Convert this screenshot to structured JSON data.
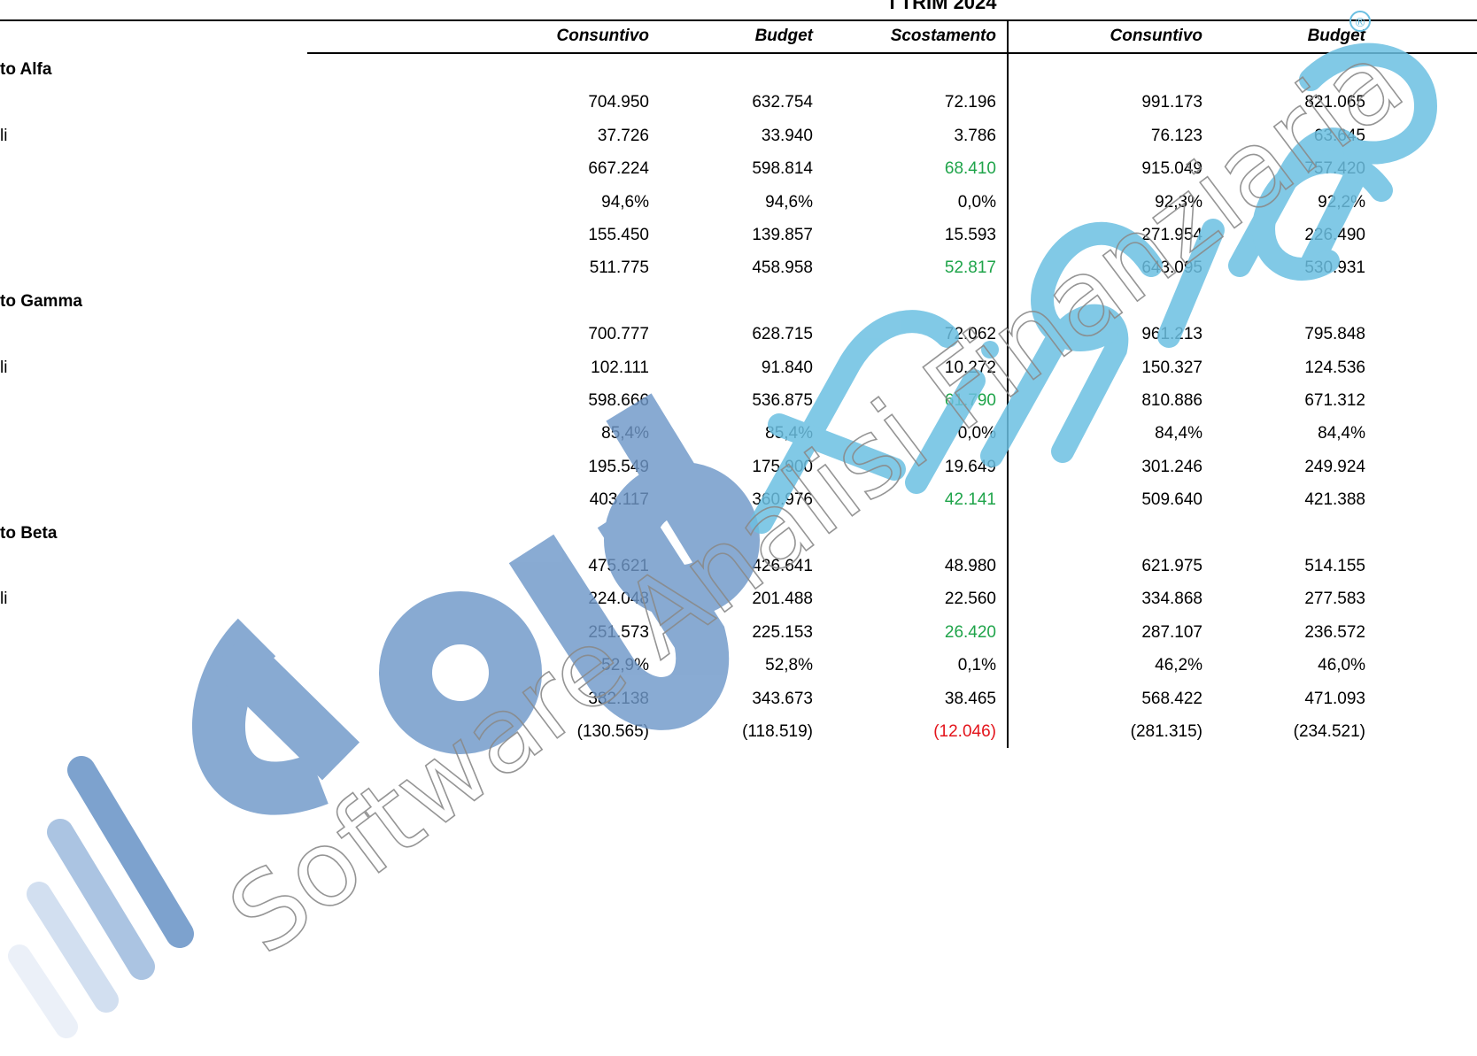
{
  "header": {
    "period": "I TRIM 2024",
    "columns": [
      "Consuntivo",
      "Budget",
      "Scostamento",
      "Consuntivo",
      "Budget"
    ]
  },
  "rows": [
    {
      "label": "to Alfa",
      "group": true,
      "values": [
        "",
        "",
        "",
        "",
        ""
      ]
    },
    {
      "label": "",
      "values": [
        "704.950",
        "632.754",
        "72.196",
        "991.173",
        "821.065"
      ]
    },
    {
      "label": "li",
      "values": [
        "37.726",
        "33.940",
        "3.786",
        "76.123",
        "63.645"
      ]
    },
    {
      "label": "",
      "values": [
        "667.224",
        "598.814",
        "68.410",
        "915.049",
        "757.420"
      ],
      "var_class": "pos"
    },
    {
      "label": "",
      "values": [
        "94,6%",
        "94,6%",
        "0,0%",
        "92,3%",
        "92,2%"
      ]
    },
    {
      "label": "",
      "values": [
        "155.450",
        "139.857",
        "15.593",
        "271.954",
        "226.490"
      ]
    },
    {
      "label": "",
      "values": [
        "511.775",
        "458.958",
        "52.817",
        "643.095",
        "530.931"
      ],
      "var_class": "pos"
    },
    {
      "label": "to Gamma",
      "group": true,
      "values": [
        "",
        "",
        "",
        "",
        ""
      ]
    },
    {
      "label": "",
      "values": [
        "700.777",
        "628.715",
        "72.062",
        "961.213",
        "795.848"
      ]
    },
    {
      "label": "li",
      "values": [
        "102.111",
        "91.840",
        "10.272",
        "150.327",
        "124.536"
      ]
    },
    {
      "label": "",
      "values": [
        "598.666",
        "536.875",
        "61.790",
        "810.886",
        "671.312"
      ],
      "var_class": "pos"
    },
    {
      "label": "",
      "values": [
        "85,4%",
        "85,4%",
        "0,0%",
        "84,4%",
        "84,4%"
      ]
    },
    {
      "label": "",
      "values": [
        "195.549",
        "175.900",
        "19.649",
        "301.246",
        "249.924"
      ]
    },
    {
      "label": "",
      "values": [
        "403.117",
        "360.976",
        "42.141",
        "509.640",
        "421.388"
      ],
      "var_class": "pos"
    },
    {
      "label": "to Beta",
      "group": true,
      "values": [
        "",
        "",
        "",
        "",
        ""
      ]
    },
    {
      "label": "",
      "values": [
        "475.621",
        "426.641",
        "48.980",
        "621.975",
        "514.155"
      ]
    },
    {
      "label": "li",
      "values": [
        "224.048",
        "201.488",
        "22.560",
        "334.868",
        "277.583"
      ]
    },
    {
      "label": "",
      "values": [
        "251.573",
        "225.153",
        "26.420",
        "287.107",
        "236.572"
      ],
      "var_class": "pos"
    },
    {
      "label": "",
      "values": [
        "52,9%",
        "52,8%",
        "0,1%",
        "46,2%",
        "46,0%"
      ]
    },
    {
      "label": "",
      "values": [
        "382.138",
        "343.673",
        "38.465",
        "568.422",
        "471.093"
      ]
    },
    {
      "label": "",
      "values": [
        "(130.565)",
        "(118.519)",
        "(12.046)",
        "(281.315)",
        "(234.521)"
      ],
      "var_class": "neg"
    }
  ],
  "watermark": {
    "brand": "cloud finance",
    "tagline": "Software Analisi Finanziaria",
    "registered": "®",
    "colors": {
      "blue_dark": "#6f98c9",
      "blue_light": "#6cc0e2",
      "tagline": "#777777"
    }
  }
}
